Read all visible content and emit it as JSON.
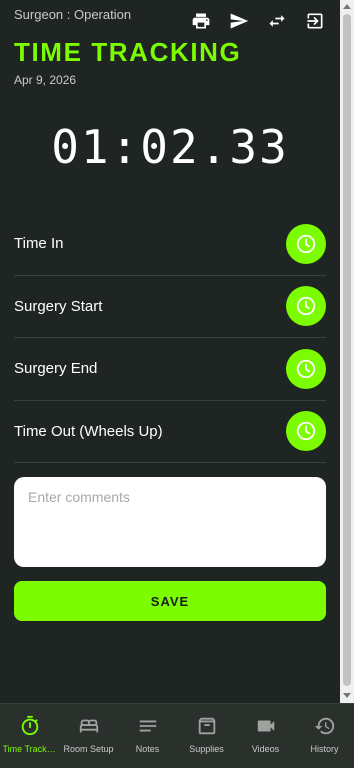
{
  "header": {
    "role": "Surgeon : Operation",
    "title": "TIME TRACKING",
    "date": "Apr 9, 2026",
    "actions": [
      {
        "icon": "print-icon"
      },
      {
        "icon": "send-icon"
      },
      {
        "icon": "swap-icon"
      },
      {
        "icon": "logout-icon"
      }
    ]
  },
  "timer": "01:02.33",
  "events": [
    {
      "label": "Time In",
      "icon": "clock-icon"
    },
    {
      "label": "Surgery Start",
      "icon": "clock-icon"
    },
    {
      "label": "Surgery End",
      "icon": "clock-icon"
    },
    {
      "label": "Time Out (Wheels Up)",
      "icon": "clock-icon"
    }
  ],
  "comments": {
    "placeholder": "Enter comments",
    "value": ""
  },
  "save_label": "SAVE",
  "nav": [
    {
      "label": "Time Tracking",
      "icon": "stopwatch-icon",
      "active": true
    },
    {
      "label": "Room Setup",
      "icon": "bed-icon",
      "active": false
    },
    {
      "label": "Notes",
      "icon": "notes-icon",
      "active": false
    },
    {
      "label": "Supplies",
      "icon": "archive-box-icon",
      "active": false
    },
    {
      "label": "Videos",
      "icon": "video-camera-icon",
      "active": false
    },
    {
      "label": "History",
      "icon": "history-icon",
      "active": false
    }
  ],
  "colors": {
    "accent": "#7cfc00",
    "background": "#1f2522",
    "nav_background": "#2a302c"
  }
}
